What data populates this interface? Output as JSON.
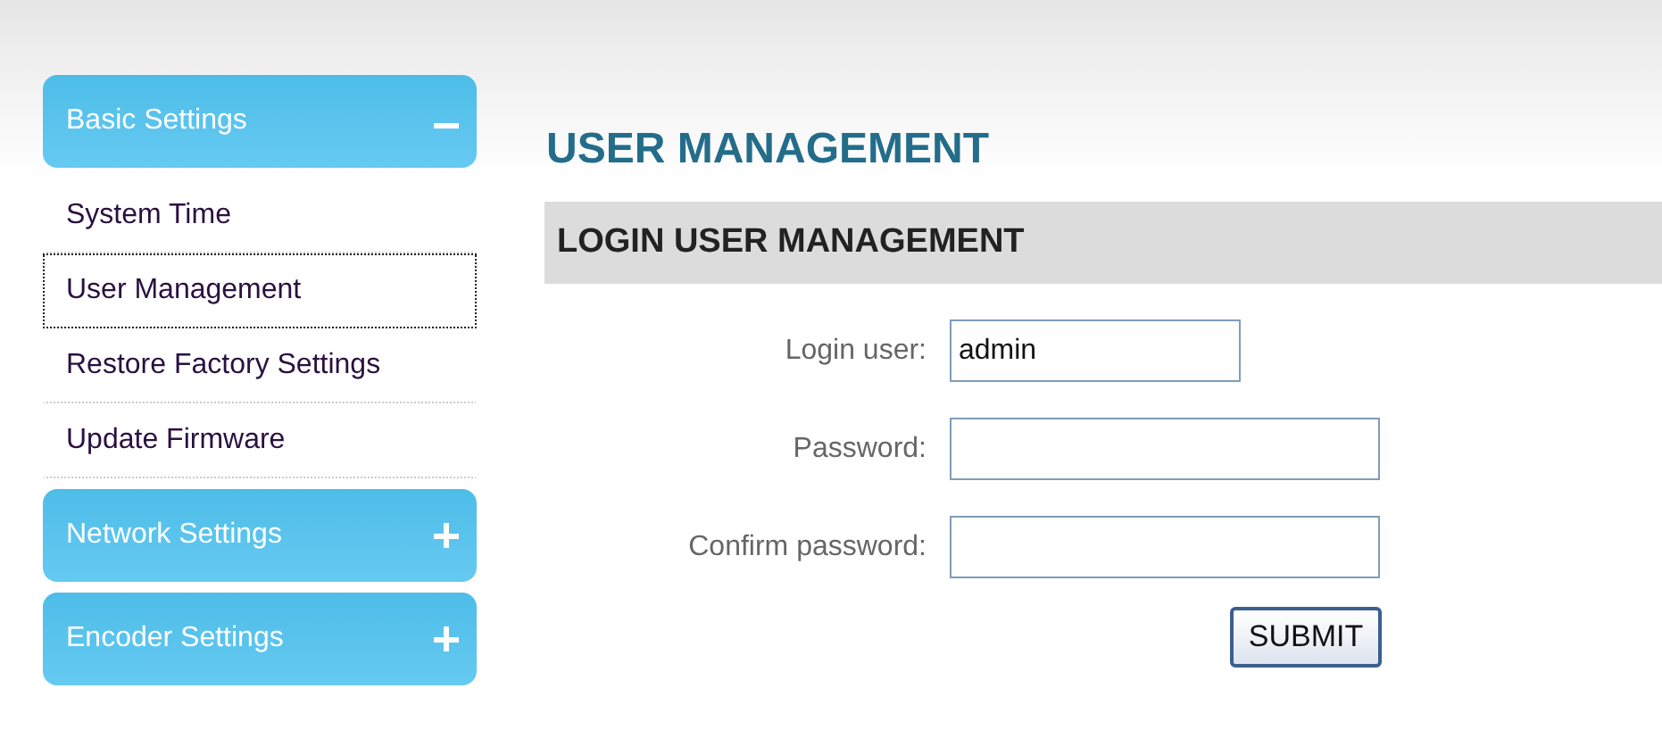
{
  "sidebar": {
    "sections": [
      {
        "title": "Basic Settings",
        "expanded": true,
        "items": [
          {
            "label": "System Time",
            "selected": false
          },
          {
            "label": "User Management",
            "selected": true
          },
          {
            "label": "Restore Factory Settings",
            "selected": false
          },
          {
            "label": "Update Firmware",
            "selected": false
          }
        ]
      },
      {
        "title": "Network Settings",
        "expanded": false
      },
      {
        "title": "Encoder Settings",
        "expanded": false
      }
    ]
  },
  "main": {
    "title": "USER MANAGEMENT",
    "section_title": "LOGIN USER MANAGEMENT",
    "fields": [
      {
        "kind": "text",
        "label": "Login user:",
        "value": "admin"
      },
      {
        "kind": "password",
        "label": "Password:"
      },
      {
        "kind": "password",
        "label": "Confirm password:"
      }
    ],
    "submit": "SUBMIT"
  }
}
